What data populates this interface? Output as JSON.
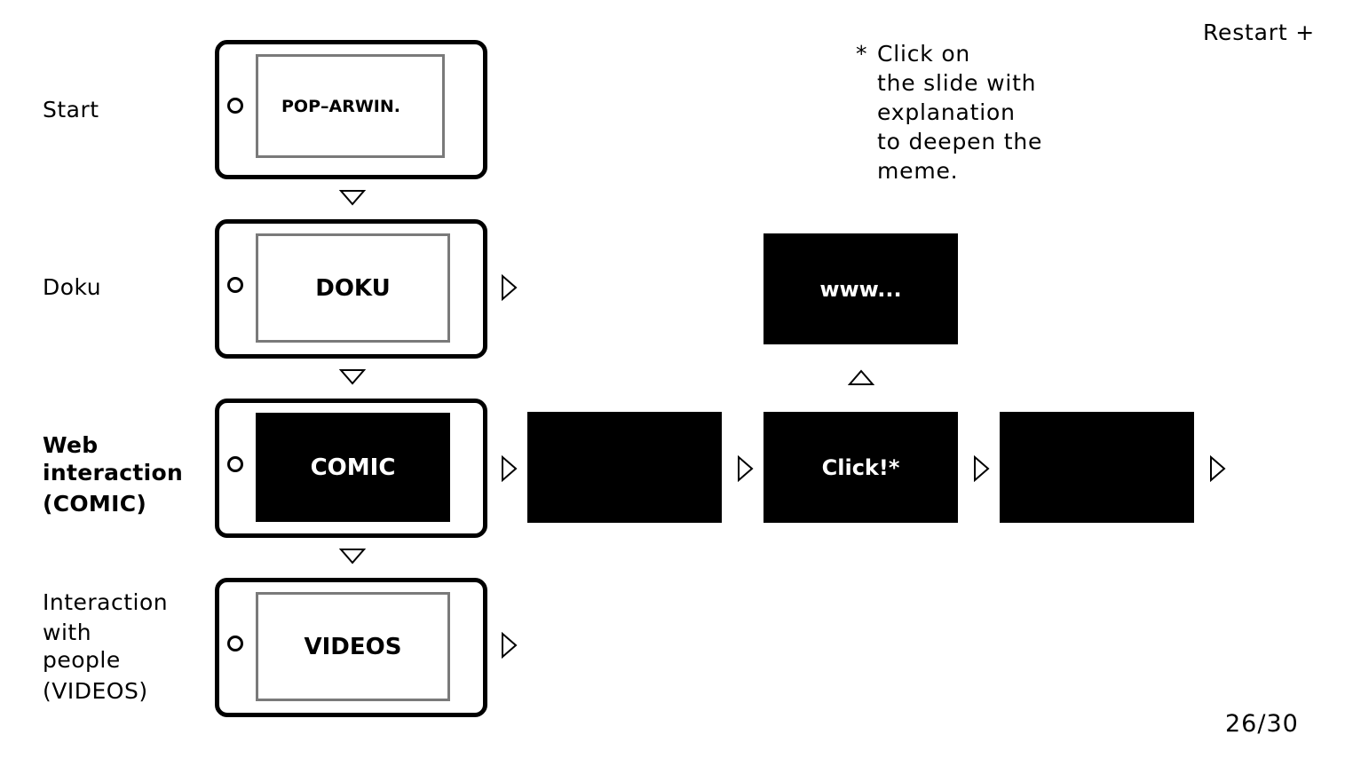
{
  "rows": {
    "start": {
      "label_lines": [
        "Start"
      ],
      "screen": "POP–ARWIN."
    },
    "doku": {
      "label_lines": [
        "Doku"
      ],
      "screen": "DOKU"
    },
    "comic": {
      "label_lines": [
        "Web",
        "interaction",
        "(COMIC)"
      ],
      "screen": "COMIC"
    },
    "videos": {
      "label_lines": [
        "Interaction",
        "with",
        "people",
        "(VIDEOS)"
      ],
      "screen": "VIDEOS"
    }
  },
  "slides": {
    "www": "www...",
    "comic_1": "",
    "click": "Click!*",
    "comic_3": ""
  },
  "note": {
    "marker": "*",
    "lines": [
      "Click on",
      "the slide with",
      "explanation",
      "to deepen the",
      "meme."
    ]
  },
  "restart_label": "Restart +",
  "page_indicator": "26/30",
  "icons": {
    "flow_arrow": "triangle-outline",
    "home_button": "circle-outline"
  },
  "colors": {
    "slide_fill": "#000000",
    "screen_border": "#7a7a7a",
    "background": "#ffffff"
  }
}
